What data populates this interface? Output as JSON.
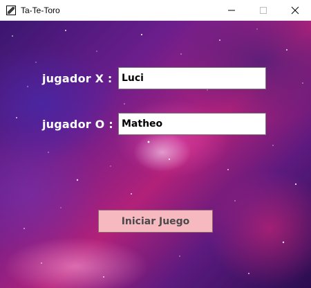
{
  "window": {
    "title": "Ta-Te-Toro",
    "icon": "app-icon",
    "controls": {
      "minimize_icon": "minimize-icon",
      "maximize_icon": "maximize-icon",
      "close_icon": "close-icon"
    }
  },
  "form": {
    "player_x": {
      "label": "jugador X :",
      "value": "Luci"
    },
    "player_o": {
      "label": "jugador O :",
      "value": "Matheo"
    },
    "start_button": {
      "label": "Iniciar Juego"
    }
  },
  "colors": {
    "button_background": "#f7b9c0",
    "label_text": "#ffffff",
    "field_background": "#ffffff"
  }
}
